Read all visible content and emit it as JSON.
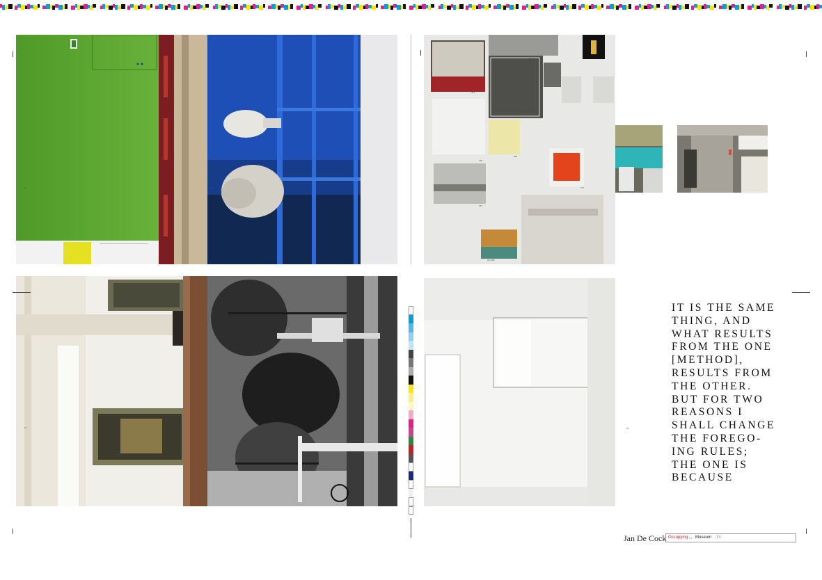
{
  "quote": {
    "lines": [
      "IT IS THE SAME",
      "THING, AND",
      "WHAT RESULTS",
      "FROM THE ONE",
      "[METHOD],",
      "RESULTS FROM",
      "THE OTHER.",
      "BUT FOR TWO",
      "REASONS I",
      "SHALL CHANGE",
      "THE FOREGO-",
      "ING RULES;",
      "THE ONE IS",
      "BECAUSE"
    ]
  },
  "footer": {
    "author": "Jan De Cock",
    "word1": "Occupying",
    "word2": "the",
    "word3": "Museum",
    "page": "33"
  },
  "captions": {
    "thumb_751": "751",
    "thumb_754": "754",
    "thumb_756": "756",
    "thumb_758": "758",
    "thumb_760": "760",
    "thumb_761": "761",
    "thumb_767": "767",
    "thumb_889": "889",
    "thumb_890": "890",
    "thumb_898": "898",
    "thumb_893": "893",
    "thumb_861": "861.01",
    "thumb_09": "09.148F"
  },
  "colors": {
    "green": "#5aa62e",
    "blue": "#1a4fb4",
    "accent_red": "#cc2a2a"
  }
}
